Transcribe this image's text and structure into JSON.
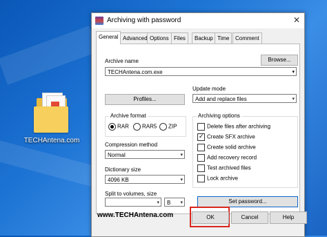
{
  "desktop": {
    "icon_label": "TECHAntena.com"
  },
  "dialog": {
    "title": "Archiving with password",
    "close_glyph": "✕",
    "tabs": [
      "General",
      "Advanced",
      "Options",
      "Files",
      "Backup",
      "Time",
      "Comment"
    ],
    "archive_name_label": "Archive name",
    "archive_name_value": "TECHAntena.com.exe",
    "browse_button": "Browse...",
    "update_mode_label": "Update mode",
    "update_mode_value": "Add and replace files",
    "profiles_button": "Profiles...",
    "archive_format": {
      "title": "Archive format",
      "options": [
        "RAR",
        "RAR5",
        "ZIP"
      ],
      "selected": "RAR"
    },
    "compression_label": "Compression method",
    "compression_value": "Normal",
    "dictionary_label": "Dictionary size",
    "dictionary_value": "4096 KB",
    "split_label": "Split to volumes, size",
    "split_value": "",
    "split_unit": "B",
    "archiving_options": {
      "title": "Archiving options",
      "items": [
        {
          "label": "Delete files after archiving",
          "checked": false
        },
        {
          "label": "Create SFX archive",
          "checked": true
        },
        {
          "label": "Create solid archive",
          "checked": false
        },
        {
          "label": "Add recovery record",
          "checked": false
        },
        {
          "label": "Test archived files",
          "checked": false
        },
        {
          "label": "Lock archive",
          "checked": false
        }
      ]
    },
    "set_password_button": "Set password...",
    "watermark": "www.TECHAntena.com",
    "ok_button": "OK",
    "cancel_button": "Cancel",
    "help_button": "Help",
    "check_glyph": "✓",
    "arrow_glyph": "▾"
  },
  "colors": {
    "highlight_frame": "#d9261c",
    "desktop_blue": "#1d73d3"
  }
}
